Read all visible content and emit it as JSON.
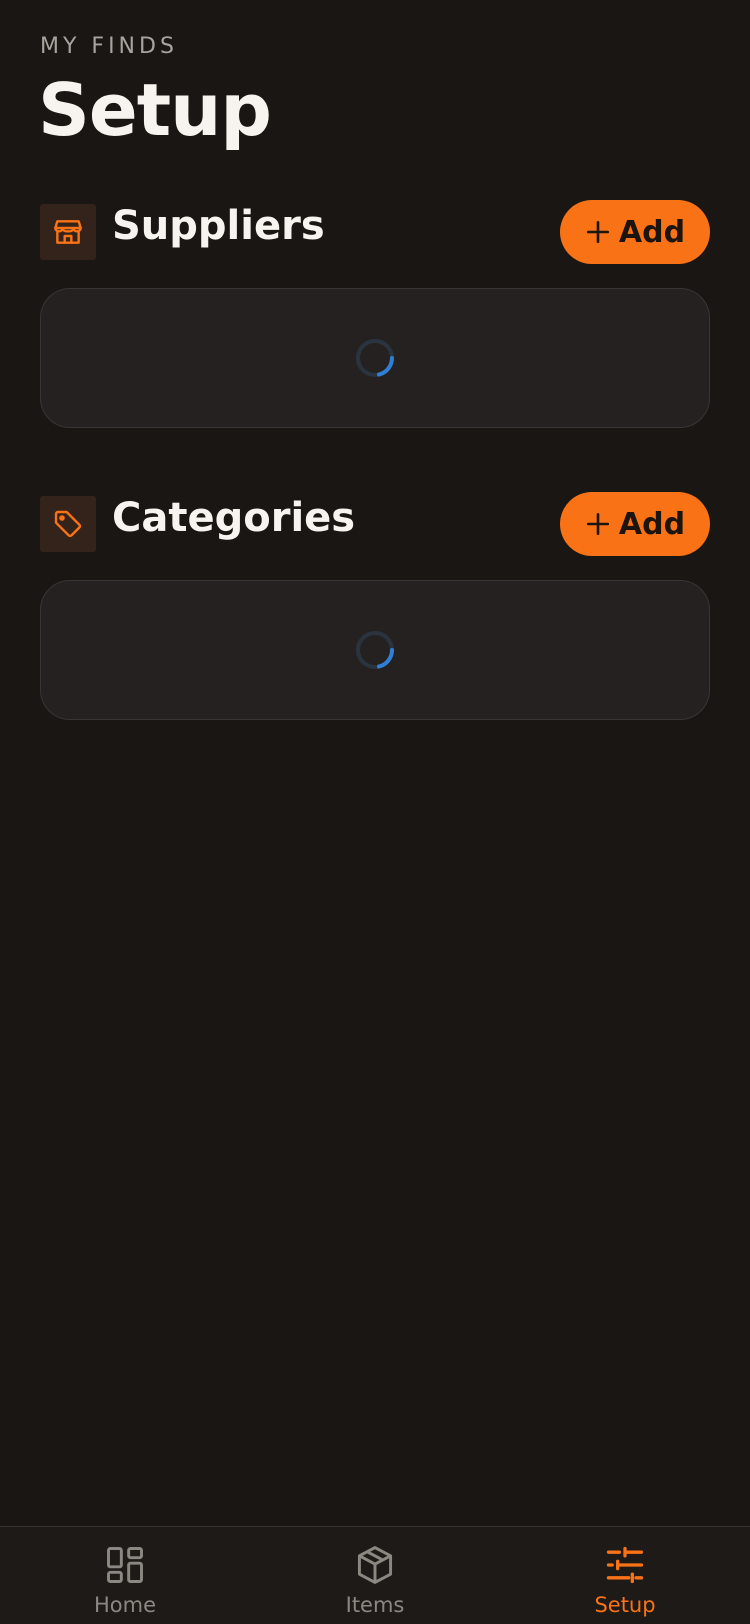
{
  "header": {
    "eyebrow": "MY FINDS",
    "title": "Setup"
  },
  "sections": [
    {
      "title": "Suppliers",
      "icon": "store-icon",
      "add_label": "Add",
      "status": "loading"
    },
    {
      "title": "Categories",
      "icon": "tag-icon",
      "add_label": "Add",
      "status": "loading"
    }
  ],
  "tabbar": {
    "items": [
      {
        "label": "Home",
        "icon": "grid-icon",
        "active": false
      },
      {
        "label": "Items",
        "icon": "box-icon",
        "active": false
      },
      {
        "label": "Setup",
        "icon": "sliders-icon",
        "active": true
      }
    ]
  },
  "colors": {
    "background": "#1a1614",
    "accent": "#f97316",
    "card": "#252120",
    "spinner": "#2f7fd6"
  }
}
